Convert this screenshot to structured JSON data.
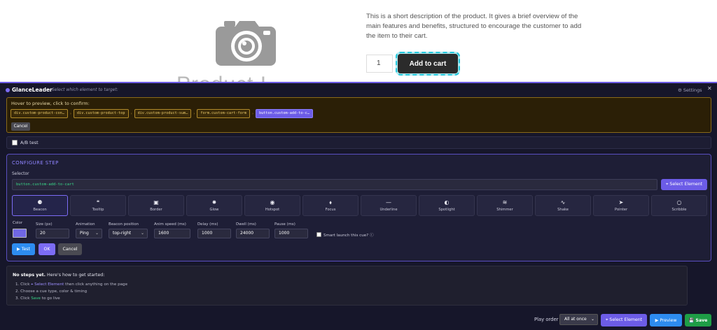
{
  "product": {
    "title_partial": "Product I",
    "description": "This is a short description of the product. It gives a brief overview of the main features and benefits, structured to encourage the customer to add the item to their cart.",
    "quantity": "1",
    "add_to_cart_label": "Add to cart",
    "image_icon": "camera-icon"
  },
  "panel": {
    "brand": "GlanceLeader",
    "hint": "Select which element to target:",
    "settings_label": "⚙ Settings",
    "close_label": "✕",
    "accent_color": "#6c5ce7"
  },
  "hover": {
    "title": "Hover to preview, click to confirm:",
    "crumbs": [
      "div.custom-product-con…",
      "div.custom-product-top",
      "div.custom-product-sum…",
      "form.custom-cart-form",
      "button.custom-add-to-c…"
    ],
    "cancel_label": "Cancel"
  },
  "ab_test": {
    "label": "A/B test"
  },
  "config": {
    "title": "CONFIGURE STEP",
    "selector_label": "Selector",
    "selector_value": "button.custom-add-to-cart",
    "select_element_label": "⌖ Select Element",
    "cue_types": [
      {
        "icon": "⚈",
        "name": "Beacon"
      },
      {
        "icon": "❝",
        "name": "Tooltip"
      },
      {
        "icon": "▣",
        "name": "Border"
      },
      {
        "icon": "✸",
        "name": "Glow"
      },
      {
        "icon": "◉",
        "name": "Hotspot"
      },
      {
        "icon": "⬧",
        "name": "Focus"
      },
      {
        "icon": "—",
        "name": "Underline"
      },
      {
        "icon": "◐",
        "name": "Spotlight"
      },
      {
        "icon": "≋",
        "name": "Shimmer"
      },
      {
        "icon": "∿",
        "name": "Shake"
      },
      {
        "icon": "➤",
        "name": "Pointer"
      },
      {
        "icon": "○",
        "name": "Scribble"
      }
    ],
    "active_cue": "Beacon",
    "fields": {
      "color_label": "Color",
      "color_value": "#7067e4",
      "size_label": "Size (px)",
      "size_value": "20",
      "animation_label": "Animation",
      "animation_value": "Ping",
      "beacon_position_label": "Beacon position",
      "beacon_position_value": "top-right",
      "anim_speed_label": "Anim speed (ms)",
      "anim_speed_value": "1600",
      "delay_label": "Delay (ms)",
      "delay_value": "1000",
      "dwell_label": "Dwell (ms)",
      "dwell_value": "24000",
      "pause_label": "Pause (ms)",
      "pause_value": "1000",
      "smart_launch_label": "Smart launch this cue? ⓘ"
    },
    "test_label": "▶ Test",
    "ok_label": "OK",
    "cancel_label": "Cancel"
  },
  "empty_state": {
    "title_bold": "No steps yet.",
    "title_rest": " Here's how to get started:",
    "step1_pre": "1. Click ",
    "step1_link": "⌖ Select Element",
    "step1_post": " then click anything on the page",
    "step2": "2. Choose a cue type, color & timing",
    "step3_pre": "3. Click ",
    "step3_link": "Save",
    "step3_post": " to go live"
  },
  "footer": {
    "play_order_label": "Play order",
    "play_order_value": "All at once",
    "select_element_label": "⌖ Select Element",
    "preview_label": "▶ Preview",
    "save_label": "💾 Save"
  }
}
